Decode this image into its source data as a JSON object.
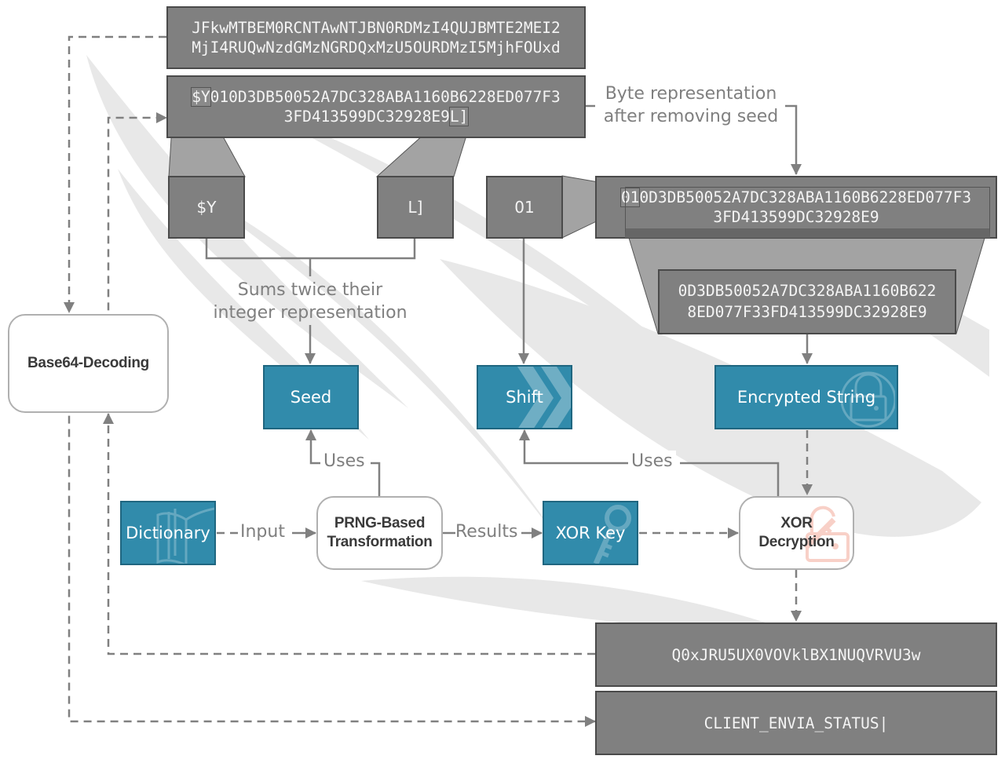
{
  "colors": {
    "grey_box": "#808080",
    "grey_border": "#4a4a4a",
    "teal": "#318bab",
    "teal_border": "#1f6680",
    "connector": "#808080",
    "label_text": "#7f7f7f",
    "watermark": "#e8e8e8",
    "decrypt_icon": "#f2a999"
  },
  "encoded_input": {
    "line1": "JFkwMTBEM0RCNTAwNTJBN0RDMzI4QUJBMTE2MEI2",
    "line2": "MjI4RUQwNzdGMzNGRDQxMzU5OURDMzI5MjhFOUxd"
  },
  "decoded_bytes": {
    "prefix": "$Y",
    "line1_rest": "010D3DB50052A7DC328ABA1160B6228ED077F3",
    "line2_main": "3FD413599DC32928E9",
    "suffix": "L]"
  },
  "annotations": {
    "byte_representation": [
      "Byte representation",
      "after removing seed"
    ],
    "sums_twice": [
      "Sums twice their",
      "integer representation"
    ],
    "uses_seed": "Uses",
    "uses_shift": "Uses",
    "input": "Input",
    "results": "Results"
  },
  "seed_chars": {
    "first": "$Y",
    "last": "L]"
  },
  "shift_value": "01",
  "without_seed": {
    "prefix": "01",
    "line1_rest": "0D3DB50052A7DC328ABA1160B6228ED077F3",
    "line2": "3FD413599DC32928E9"
  },
  "encrypted_payload": {
    "line1": "0D3DB50052A7DC328ABA1160B622",
    "line2": "8ED077F33FD413599DC32928E9"
  },
  "nodes": {
    "base64_decoding": "Base64-Decoding",
    "seed": "Seed",
    "shift": "Shift",
    "encrypted_string": "Encrypted String",
    "dictionary": "Dictionary",
    "prng": [
      "PRNG-Based",
      "Transformation"
    ],
    "xor_key": "XOR Key",
    "xor_decryption": [
      "XOR",
      "Decryption"
    ]
  },
  "icons": {
    "shift": "chevron-right-icon",
    "encrypted_string": "padlock-icon",
    "dictionary": "book-icon",
    "xor_key": "key-icon",
    "xor_decryption": "unlock-key-icon"
  },
  "xor_output": "Q0xJRU5UX0VOVklBX1NUQVRVU3w",
  "final_output": "CLIENT_ENVIA_STATUS|"
}
